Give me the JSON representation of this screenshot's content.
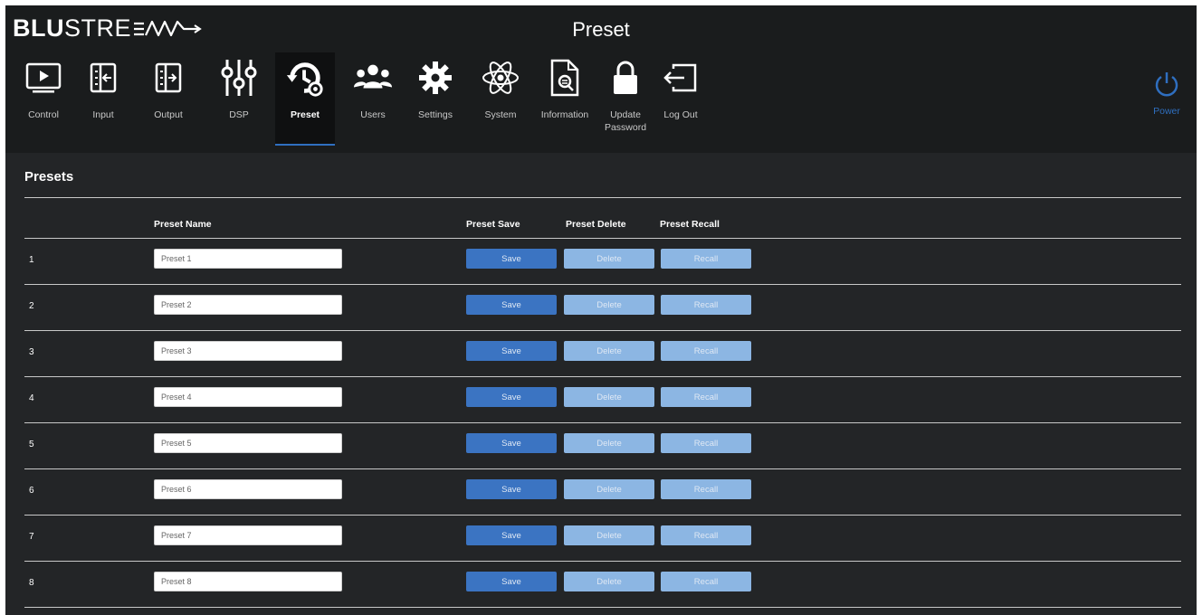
{
  "brand": {
    "bold": "BLU",
    "light": "STRE"
  },
  "page_title": "Preset",
  "nav": [
    {
      "label": "Control",
      "icon": "monitor-play-icon"
    },
    {
      "label": "Input",
      "icon": "input-arrow-icon"
    },
    {
      "label": "Output",
      "icon": "output-arrow-icon"
    },
    {
      "label": "DSP",
      "icon": "sliders-icon"
    },
    {
      "label": "Preset",
      "icon": "history-gear-icon",
      "active": true
    },
    {
      "label": "Users",
      "icon": "users-icon"
    },
    {
      "label": "Settings",
      "icon": "gear-icon"
    },
    {
      "label": "System",
      "icon": "atom-icon"
    },
    {
      "label": "Information",
      "icon": "document-search-icon"
    },
    {
      "label": "Update Password",
      "icon": "lock-icon"
    },
    {
      "label": "Log Out",
      "icon": "logout-icon"
    }
  ],
  "power": {
    "label": "Power",
    "icon": "power-icon",
    "color": "#2f6fc0"
  },
  "section": {
    "title": "Presets"
  },
  "columns": {
    "name": "Preset Name",
    "save": "Preset Save",
    "delete": "Preset Delete",
    "recall": "Preset Recall"
  },
  "rows": [
    {
      "num": "1",
      "name": "Preset 1",
      "save": "Save",
      "delete": "Delete",
      "recall": "Recall"
    },
    {
      "num": "2",
      "name": "Preset 2",
      "save": "Save",
      "delete": "Delete",
      "recall": "Recall"
    },
    {
      "num": "3",
      "name": "Preset 3",
      "save": "Save",
      "delete": "Delete",
      "recall": "Recall"
    },
    {
      "num": "4",
      "name": "Preset 4",
      "save": "Save",
      "delete": "Delete",
      "recall": "Recall"
    },
    {
      "num": "5",
      "name": "Preset 5",
      "save": "Save",
      "delete": "Delete",
      "recall": "Recall"
    },
    {
      "num": "6",
      "name": "Preset 6",
      "save": "Save",
      "delete": "Delete",
      "recall": "Recall"
    },
    {
      "num": "7",
      "name": "Preset 7",
      "save": "Save",
      "delete": "Delete",
      "recall": "Recall"
    },
    {
      "num": "8",
      "name": "Preset 8",
      "save": "Save",
      "delete": "Delete",
      "recall": "Recall"
    }
  ],
  "colors": {
    "save_button": "#3b74c2",
    "secondary_button": "#8cb6e3",
    "accent": "#2f6fc0",
    "background": "#232527",
    "header": "#1a1c1d"
  }
}
